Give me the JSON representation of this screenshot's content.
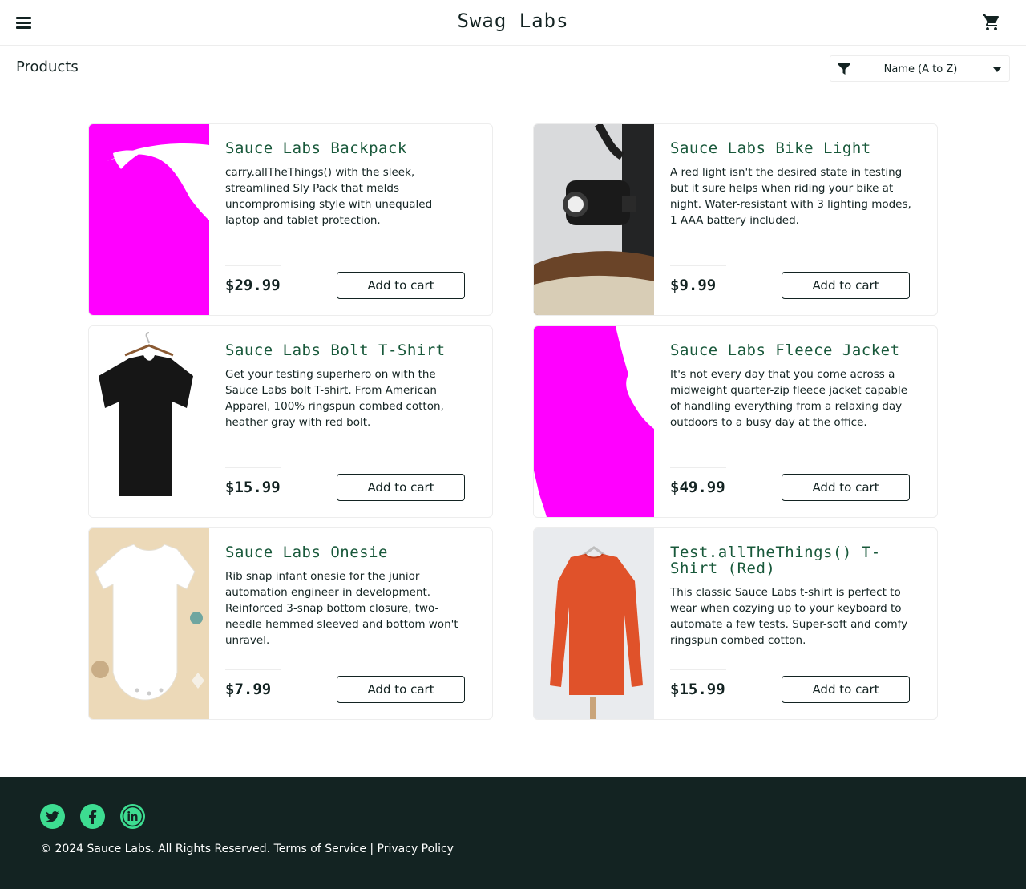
{
  "header": {
    "menu_icon": "menu-icon",
    "logo": "Swag Labs",
    "cart_icon": "shopping-cart-icon"
  },
  "sub_header": {
    "title": "Products",
    "sort": {
      "icon": "filter-icon",
      "selected": "Name (A to Z)",
      "caret_icon": "caret-down-icon"
    }
  },
  "products": [
    {
      "name": "Sauce Labs Backpack",
      "description": "carry.allTheThings() with the sleek, streamlined Sly Pack that melds uncompromising style with unequaled laptop and tablet protection.",
      "price": "$29.99",
      "button": "Add to cart"
    },
    {
      "name": "Sauce Labs Bike Light",
      "description": "A red light isn't the desired state in testing but it sure helps when riding your bike at night. Water-resistant with 3 lighting modes, 1 AAA battery included.",
      "price": "$9.99",
      "button": "Add to cart"
    },
    {
      "name": "Sauce Labs Bolt T-Shirt",
      "description": "Get your testing superhero on with the Sauce Labs bolt T-shirt. From American Apparel, 100% ringspun combed cotton, heather gray with red bolt.",
      "price": "$15.99",
      "button": "Add to cart"
    },
    {
      "name": "Sauce Labs Fleece Jacket",
      "description": "It's not every day that you come across a midweight quarter-zip fleece jacket capable of handling everything from a relaxing day outdoors to a busy day at the office.",
      "price": "$49.99",
      "button": "Add to cart"
    },
    {
      "name": "Sauce Labs Onesie",
      "description": "Rib snap infant onesie for the junior automation engineer in development. Reinforced 3-snap bottom closure, two-needle hemmed sleeved and bottom won't unravel.",
      "price": "$7.99",
      "button": "Add to cart"
    },
    {
      "name": "Test.allTheThings() T-Shirt (Red)",
      "description": "This classic Sauce Labs t-shirt is perfect to wear when cozying up to your keyboard to automate a few tests. Super-soft and comfy ringspun combed cotton.",
      "price": "$15.99",
      "button": "Add to cart"
    }
  ],
  "footer": {
    "social": [
      "twitter-icon",
      "facebook-icon",
      "linkedin-icon"
    ],
    "copy": "© 2024 Sauce Labs. All Rights Reserved. Terms of Service | Privacy Policy"
  },
  "colors": {
    "accent_green": "#18583a",
    "dark": "#132322",
    "social_green": "#3ddc91",
    "broken_image": "#ff00ff"
  }
}
